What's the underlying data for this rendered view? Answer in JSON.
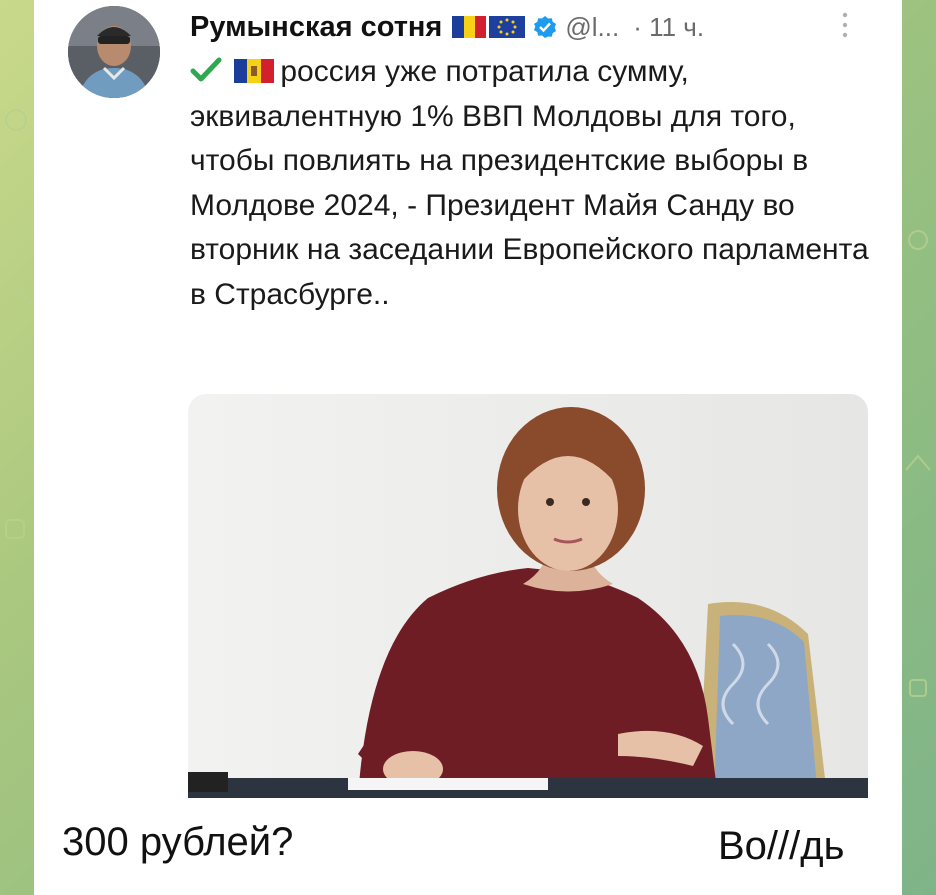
{
  "post": {
    "author_name": "Румынская сотня",
    "handle": "@l...",
    "time": "· 11 ч.",
    "text": "россия уже потратила сумму, эквивалентную 1% ВВП Молдовы для того, чтобы повлиять на президентские выборы в Молдове 2024, - Президент Майя Санду во вторник на заседании Европейского парламента в Страсбурге..",
    "icons": [
      "avatar",
      "romania-flag-icon",
      "eu-flag-icon",
      "verified-badge-icon",
      "more-options-icon",
      "check-mark-icon",
      "moldova-flag-icon",
      "photo"
    ]
  },
  "caption": {
    "left": "300 рублей?",
    "right": "Во///дь"
  },
  "colors": {
    "background_green": "#9cc27f",
    "card": "#ffffff",
    "verified": "#1d9bf0",
    "check": "#2fa84f",
    "dress": "#6e1d24"
  }
}
